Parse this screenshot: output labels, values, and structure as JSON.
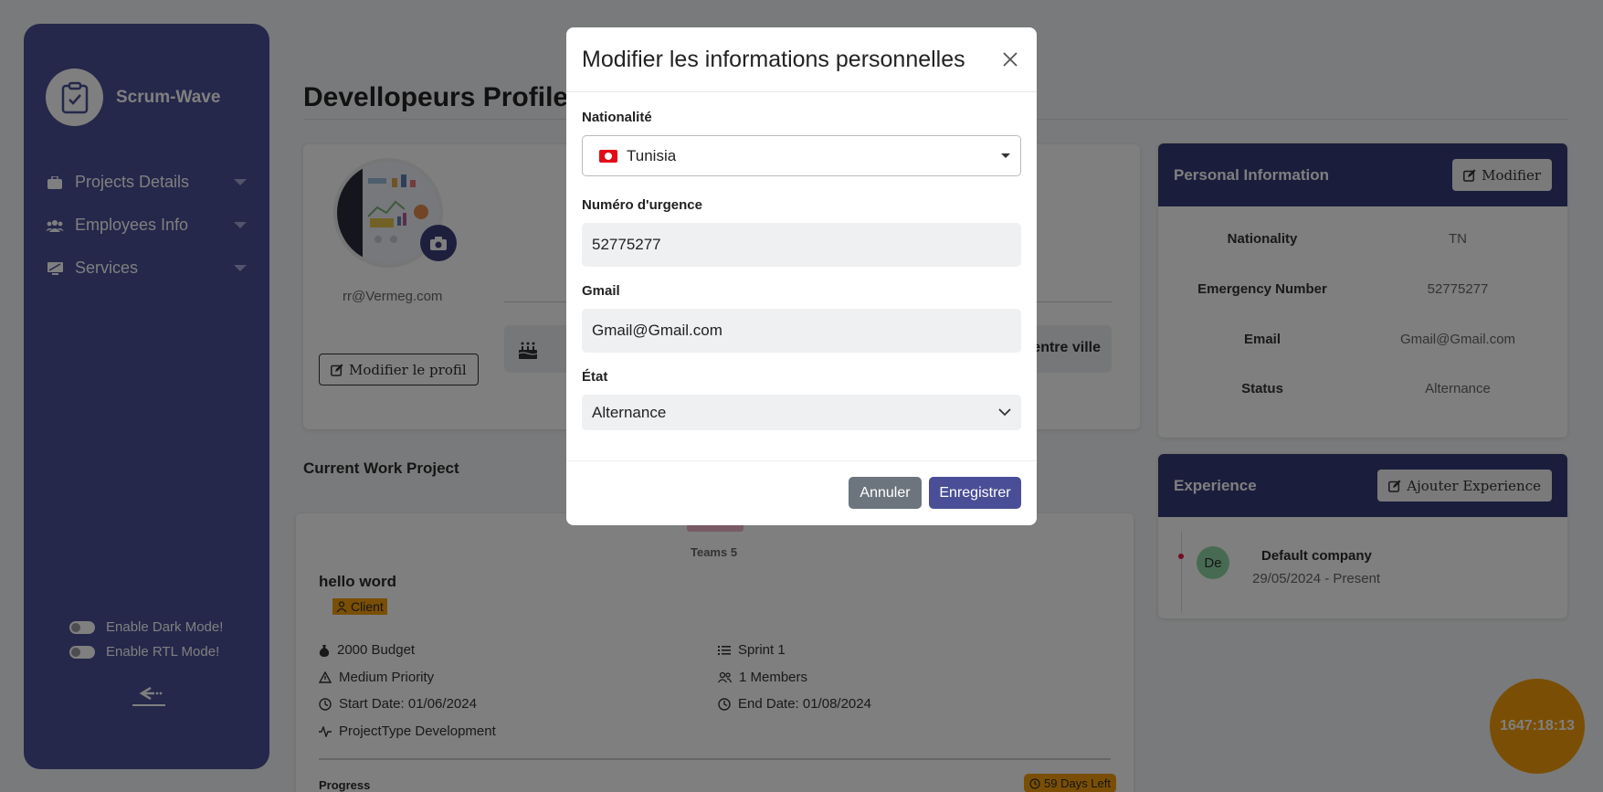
{
  "sidebar": {
    "brand": "Scrum-Wave",
    "items": [
      {
        "label": "Projects Details"
      },
      {
        "label": "Employees Info"
      },
      {
        "label": "Services"
      }
    ],
    "toggles": [
      {
        "label": "Enable Dark Mode!"
      },
      {
        "label": "Enable RTL Mode!"
      }
    ]
  },
  "page": {
    "title": "Devellopeurs Profile"
  },
  "profile": {
    "email": "rr@Vermeg.com",
    "edit_label": "Modifier le profil",
    "address_fragment": "entre ville"
  },
  "project": {
    "section_title": "Current Work Project",
    "team": "Teams 5",
    "name": "hello word",
    "client": "Client",
    "budget": "2000 Budget",
    "priority": "Medium Priority",
    "start": "Start Date: 01/06/2024",
    "type": "ProjectType Development",
    "sprint": "Sprint 1",
    "members": "1 Members",
    "end": "End Date: 01/08/2024",
    "progress_label": "Progress",
    "days_left": "59 Days Left"
  },
  "personal_info": {
    "title": "Personal Information",
    "edit_label": "Modifier",
    "rows": [
      {
        "key": "Nationality",
        "value": "TN"
      },
      {
        "key": "Emergency Number",
        "value": "52775277"
      },
      {
        "key": "Email",
        "value": "Gmail@Gmail.com"
      },
      {
        "key": "Status",
        "value": "Alternance"
      }
    ]
  },
  "experience": {
    "title": "Experience",
    "add_label": "Ajouter Experience",
    "avatar": "De",
    "company": "Default company",
    "dates": "29/05/2024 - Present"
  },
  "timer": "1647:18:13",
  "modal": {
    "title": "Modifier les informations personnelles",
    "nationality_label": "Nationalité",
    "nationality_value": "Tunisia",
    "emergency_label": "Numéro d'urgence",
    "emergency_value": "52775277",
    "gmail_label": "Gmail",
    "gmail_value": "Gmail@Gmail.com",
    "state_label": "État",
    "state_value": "Alternance",
    "cancel_label": "Annuler",
    "save_label": "Enregistrer"
  },
  "colors": {
    "sidebar": "#4a4e96",
    "header": "#363a78",
    "accent": "#f59e0b"
  }
}
